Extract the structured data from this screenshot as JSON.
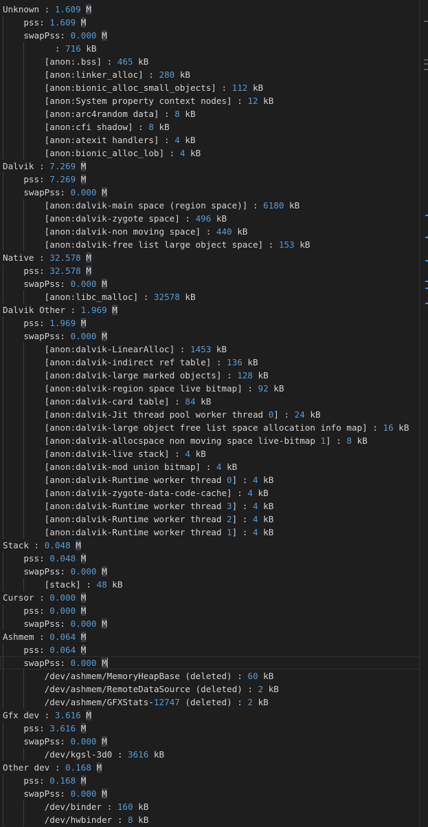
{
  "editor": {
    "lines": [
      {
        "indent": 0,
        "label": "Unknown : ",
        "value": "1.609",
        "unit": "M"
      },
      {
        "indent": 1,
        "label": "pss: ",
        "value": "1.609",
        "unit": "M"
      },
      {
        "indent": 1,
        "label": "swapPss: ",
        "value": "0.000",
        "unit": "M"
      },
      {
        "indent": 2,
        "label": "  : ",
        "value": "716",
        "unit": " kB"
      },
      {
        "indent": 2,
        "label": "[anon:.bss] : ",
        "value": "465",
        "unit": " kB"
      },
      {
        "indent": 2,
        "label": "[anon:linker_alloc] : ",
        "value": "280",
        "unit": " kB"
      },
      {
        "indent": 2,
        "label": "[anon:bionic_alloc_small_objects] : ",
        "value": "112",
        "unit": " kB"
      },
      {
        "indent": 2,
        "label": "[anon:System property context nodes] : ",
        "value": "12",
        "unit": " kB"
      },
      {
        "indent": 2,
        "label": "[anon:arc4random data] : ",
        "value": "8",
        "unit": " kB"
      },
      {
        "indent": 2,
        "label": "[anon:cfi shadow] : ",
        "value": "8",
        "unit": " kB"
      },
      {
        "indent": 2,
        "label": "[anon:atexit handlers] : ",
        "value": "4",
        "unit": " kB"
      },
      {
        "indent": 2,
        "label": "[anon:bionic_alloc_lob] : ",
        "value": "4",
        "unit": " kB"
      },
      {
        "indent": 0,
        "label": "Dalvik : ",
        "value": "7.269",
        "unit": "M"
      },
      {
        "indent": 1,
        "label": "pss: ",
        "value": "7.269",
        "unit": "M"
      },
      {
        "indent": 1,
        "label": "swapPss: ",
        "value": "0.000",
        "unit": "M"
      },
      {
        "indent": 2,
        "label": "[anon:dalvik-main space (region space)] : ",
        "value": "6180",
        "unit": " kB"
      },
      {
        "indent": 2,
        "label": "[anon:dalvik-zygote space] : ",
        "value": "496",
        "unit": " kB"
      },
      {
        "indent": 2,
        "label": "[anon:dalvik-non moving space] : ",
        "value": "440",
        "unit": " kB"
      },
      {
        "indent": 2,
        "label": "[anon:dalvik-free list large object space] : ",
        "value": "153",
        "unit": " kB"
      },
      {
        "indent": 0,
        "label": "Native : ",
        "value": "32.578",
        "unit": "M"
      },
      {
        "indent": 1,
        "label": "pss: ",
        "value": "32.578",
        "unit": "M"
      },
      {
        "indent": 1,
        "label": "swapPss: ",
        "value": "0.000",
        "unit": "M"
      },
      {
        "indent": 2,
        "label": "[anon:libc_malloc] : ",
        "value": "32578",
        "unit": " kB"
      },
      {
        "indent": 0,
        "label": "Dalvik Other : ",
        "value": "1.969",
        "unit": "M"
      },
      {
        "indent": 1,
        "label": "pss: ",
        "value": "1.969",
        "unit": "M"
      },
      {
        "indent": 1,
        "label": "swapPss: ",
        "value": "0.000",
        "unit": "M"
      },
      {
        "indent": 2,
        "label": "[anon:dalvik-LinearAlloc] : ",
        "value": "1453",
        "unit": " kB"
      },
      {
        "indent": 2,
        "label": "[anon:dalvik-indirect ref table] : ",
        "value": "136",
        "unit": " kB"
      },
      {
        "indent": 2,
        "label": "[anon:dalvik-large marked objects] : ",
        "value": "128",
        "unit": " kB"
      },
      {
        "indent": 2,
        "label": "[anon:dalvik-region space live bitmap] : ",
        "value": "92",
        "unit": " kB"
      },
      {
        "indent": 2,
        "label": "[anon:dalvik-card table] : ",
        "value": "84",
        "unit": " kB"
      },
      {
        "indent": 2,
        "label": "[anon:dalvik-Jit thread pool worker thread ",
        "mid": "0",
        "label2": "] : ",
        "value": "24",
        "unit": " kB"
      },
      {
        "indent": 2,
        "label": "[anon:dalvik-large object free list space allocation info map] : ",
        "value": "16",
        "unit": " kB"
      },
      {
        "indent": 2,
        "label": "[anon:dalvik-allocspace non moving space live-bitmap ",
        "mid": "1",
        "label2": "] : ",
        "value": "8",
        "unit": " kB"
      },
      {
        "indent": 2,
        "label": "[anon:dalvik-live stack] : ",
        "value": "4",
        "unit": " kB"
      },
      {
        "indent": 2,
        "label": "[anon:dalvik-mod union bitmap] : ",
        "value": "4",
        "unit": " kB"
      },
      {
        "indent": 2,
        "label": "[anon:dalvik-Runtime worker thread ",
        "mid": "0",
        "label2": "] : ",
        "value": "4",
        "unit": " kB"
      },
      {
        "indent": 2,
        "label": "[anon:dalvik-zygote-data-code-cache] : ",
        "value": "4",
        "unit": " kB"
      },
      {
        "indent": 2,
        "label": "[anon:dalvik-Runtime worker thread ",
        "mid": "3",
        "label2": "] : ",
        "value": "4",
        "unit": " kB"
      },
      {
        "indent": 2,
        "label": "[anon:dalvik-Runtime worker thread ",
        "mid": "2",
        "label2": "] : ",
        "value": "4",
        "unit": " kB"
      },
      {
        "indent": 2,
        "label": "[anon:dalvik-Runtime worker thread ",
        "mid": "1",
        "label2": "] : ",
        "value": "4",
        "unit": " kB"
      },
      {
        "indent": 0,
        "label": "Stack : ",
        "value": "0.048",
        "unit": "M"
      },
      {
        "indent": 1,
        "label": "pss: ",
        "value": "0.048",
        "unit": "M"
      },
      {
        "indent": 1,
        "label": "swapPss: ",
        "value": "0.000",
        "unit": "M"
      },
      {
        "indent": 2,
        "label": "[stack] : ",
        "value": "48",
        "unit": " kB"
      },
      {
        "indent": 0,
        "label": "Cursor : ",
        "value": "0.000",
        "unit": "M"
      },
      {
        "indent": 1,
        "label": "pss: ",
        "value": "0.000",
        "unit": "M"
      },
      {
        "indent": 1,
        "label": "swapPss: ",
        "value": "0.000",
        "unit": "M"
      },
      {
        "indent": 0,
        "label": "Ashmem : ",
        "value": "0.064",
        "unit": "M"
      },
      {
        "indent": 1,
        "label": "pss: ",
        "value": "0.064",
        "unit": "M"
      },
      {
        "indent": 1,
        "label": "swapPss: ",
        "value": "0.000",
        "unit": "M",
        "cursor": true
      },
      {
        "indent": 2,
        "label": "/dev/ashmem/MemoryHeapBase (deleted) : ",
        "value": "60",
        "unit": " kB"
      },
      {
        "indent": 2,
        "label": "/dev/ashmem/RemoteDataSource (deleted) : ",
        "value": "2",
        "unit": " kB"
      },
      {
        "indent": 2,
        "label": "/dev/ashmem/GFXStats-",
        "mid": "12747",
        "label2": " (deleted) : ",
        "value": "2",
        "unit": " kB"
      },
      {
        "indent": 0,
        "label": "Gfx dev : ",
        "value": "3.616",
        "unit": "M"
      },
      {
        "indent": 1,
        "label": "pss: ",
        "value": "3.616",
        "unit": "M"
      },
      {
        "indent": 1,
        "label": "swapPss: ",
        "value": "0.000",
        "unit": "M"
      },
      {
        "indent": 2,
        "label": "/dev/kgsl-3d0 : ",
        "value": "3616",
        "unit": " kB"
      },
      {
        "indent": 0,
        "label": "Other dev : ",
        "value": "0.168",
        "unit": "M"
      },
      {
        "indent": 1,
        "label": "pss: ",
        "value": "0.168",
        "unit": "M"
      },
      {
        "indent": 1,
        "label": "swapPss: ",
        "value": "0.000",
        "unit": "M"
      },
      {
        "indent": 2,
        "label": "/dev/binder : ",
        "value": "160",
        "unit": " kB"
      },
      {
        "indent": 2,
        "label": "/dev/hwbinder : ",
        "value": "8",
        "unit": " kB"
      }
    ]
  },
  "colors": {
    "background": "#1e1e1e",
    "text": "#d4d4d4",
    "number": "#569cd6"
  }
}
